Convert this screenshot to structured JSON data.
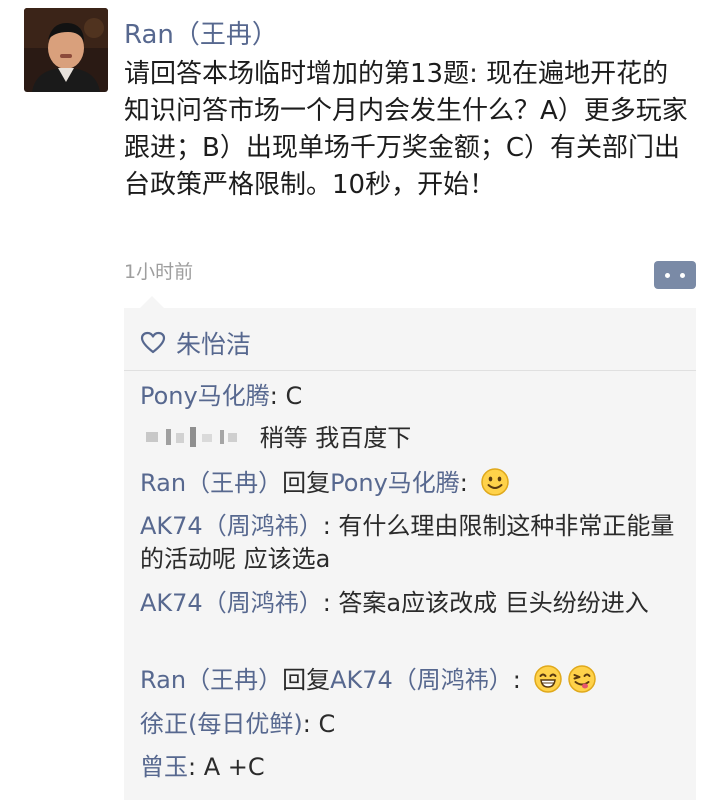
{
  "post": {
    "author": "Ran（王冉）",
    "text": "请回答本场临时增加的第13题: 现在遍地开花的知识问答市场一个月内会发生什么？A）更多玩家跟进；B）出现单场千万奖金额；C）有关部门出台政策严格限制。10秒，开始！",
    "timestamp": "1小时前"
  },
  "likes": {
    "icon": "heart-outline-icon",
    "names": "朱怡洁"
  },
  "comments": [
    {
      "author": "Pony马化腾",
      "separator": ": ",
      "text": "C"
    },
    {
      "author": "",
      "redacted": true,
      "text": "稍等 我百度下"
    },
    {
      "author": "Ran（王冉）",
      "reply_word": "回复",
      "reply_to": "Pony马化腾",
      "separator": ": ",
      "emoji": "smile-emoji"
    },
    {
      "author": "AK74（周鸿祎）",
      "separator": ": ",
      "text": "有什么理由限制这种非常正能量的活动呢 应该选a"
    },
    {
      "author": "AK74（周鸿祎）",
      "separator": ": ",
      "text": "答案a应该改成 巨头纷纷进入"
    },
    {
      "author": "Ran（王冉）",
      "reply_word": "回复",
      "reply_to": "AK74（周鸿祎）",
      "separator": ": ",
      "emoji": [
        "grin-emoji",
        "wink-tongue-emoji"
      ]
    },
    {
      "author": "徐正(每日优鲜)",
      "separator": ": ",
      "text": "C"
    },
    {
      "author": "曾玉",
      "separator": ": ",
      "text": "A +C"
    }
  ],
  "colors": {
    "link": "#57688f",
    "bubble": "#f5f5f5",
    "timestamp": "#9e9e9e",
    "comment_button": "#7a8aa6"
  }
}
